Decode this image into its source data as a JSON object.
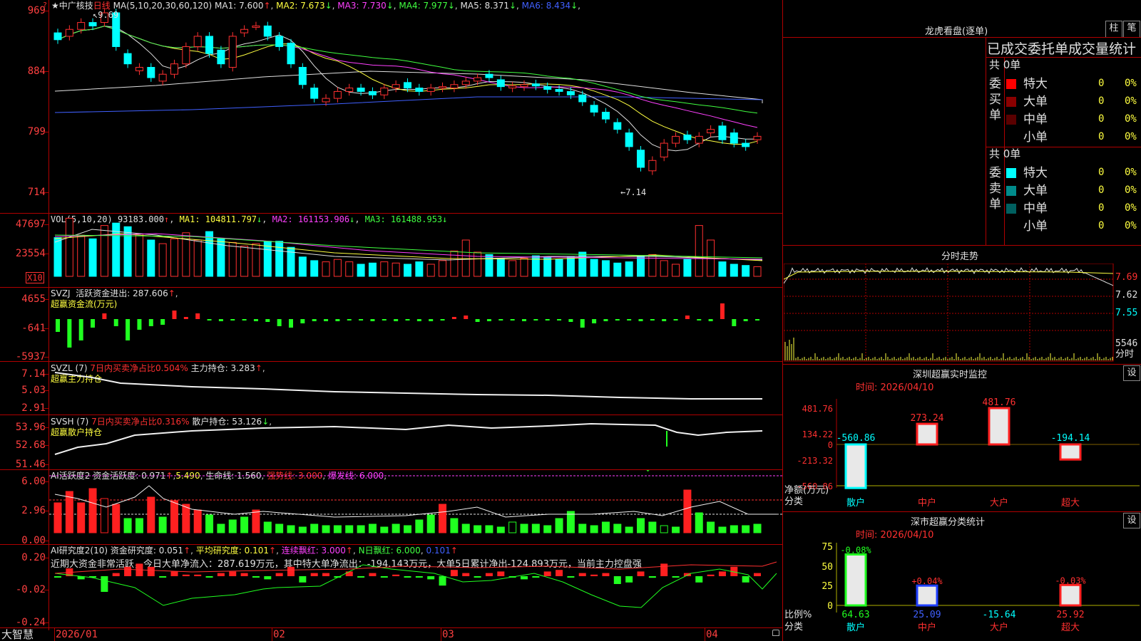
{
  "main": {
    "stock_name": "★中广核技",
    "period": "日线",
    "ma_label": "MA(5,10,20,30,60,120)",
    "ma_values": [
      {
        "label": "MA1: 7.600",
        "arrow": "↑",
        "color": "#e0e0e0"
      },
      {
        "label": "MA2: 7.673",
        "arrow": "↓",
        "color": "#ffff40"
      },
      {
        "label": "MA3: 7.730",
        "arrow": "↓",
        "color": "#ff40ff"
      },
      {
        "label": "MA4: 7.977",
        "arrow": "↓",
        "color": "#40ff40"
      },
      {
        "label": "MA5: 8.371",
        "arrow": "↓",
        "color": "#e0e0e0"
      },
      {
        "label": "MA6: 8.434",
        "arrow": "↓",
        "color": "#4060ff"
      }
    ],
    "y_ticks": [
      "969",
      "884",
      "799",
      "714"
    ],
    "high_marker": "9.69",
    "low_marker": "7.14"
  },
  "vol": {
    "label": "VOL(5,10,20)",
    "value": "93183.000",
    "ma1": "MA1: 104811.797",
    "ma2": "MA2: 161153.906",
    "ma3": "MA3: 161488.953",
    "y_ticks": [
      "47697",
      "23554"
    ],
    "unit": "X10"
  },
  "svzj": {
    "label": "SVZJ",
    "text1": "活跃资金进出: 287.606",
    "text2": "超赢资金流(万元)",
    "y_ticks": [
      "4655",
      "-641",
      "-5937"
    ]
  },
  "svzl": {
    "label": "SVZL (7)",
    "text1": "7日内买卖净占比0.504%",
    "text2": "主力持仓: 3.283",
    "text3": "超赢主力持仓",
    "y_ticks": [
      "7.14",
      "5.03",
      "2.91"
    ]
  },
  "svsh": {
    "label": "SVSH (7)",
    "text1": "7日内买卖净占比0.316%",
    "text2": "散户持仓: 53.126",
    "text3": "超赢散户持仓",
    "y_ticks": [
      "53.96",
      "52.68",
      "51.46"
    ]
  },
  "ai1": {
    "label": "AI活跃度2",
    "text1": "资金活跃度: 0.971",
    "text2": "5.490",
    "text3": "生命线: 1.560",
    "text4": "强势线: 3.000",
    "text5": "爆发线: 6.000",
    "y_ticks": [
      "6.00",
      "2.96",
      "0.00"
    ]
  },
  "ai2": {
    "label": "AI研究度2(10)",
    "text1": "资金研究度: 0.051",
    "text2": "平均研究度: 0.101",
    "text3": "连续飘红: 3.000",
    "text4": "N日飘红: 6.000",
    "text5": "0.101",
    "comment": "近期大资金非常活跃，今日大单净流入：287.619万元，其中特大单净流出：-194.143万元，大单5日累计净出-124.893万元，当前主力控盘强",
    "y_ticks": [
      "0.20",
      "-0.02",
      "-0.24"
    ]
  },
  "x_axis": {
    "brand": "大智慧",
    "dates": [
      "2026/01",
      "02",
      "03",
      "04"
    ]
  },
  "right": {
    "top_title": "龙虎看盘(逐单)",
    "btn_zhu": "柱",
    "btn_bi": "笔",
    "subtitle": "已成交委托单成交量统计",
    "buy": {
      "side_label": "委买单",
      "total": "共 0单",
      "rows": [
        {
          "name": "特大",
          "count": "0",
          "pct": "0%",
          "color": "#ff0000"
        },
        {
          "name": "大单",
          "count": "0",
          "pct": "0%",
          "color": "#8b0000"
        },
        {
          "name": "中单",
          "count": "0",
          "pct": "0%",
          "color": "#5a0000"
        },
        {
          "name": "小单",
          "count": "0",
          "pct": "0%",
          "color": "#000000"
        }
      ]
    },
    "sell": {
      "side_label": "委卖单",
      "total": "共 0单",
      "rows": [
        {
          "name": "特大",
          "count": "0",
          "pct": "0%",
          "color": "#00ffff"
        },
        {
          "name": "大单",
          "count": "0",
          "pct": "0%",
          "color": "#008b8b"
        },
        {
          "name": "中单",
          "count": "0",
          "pct": "0%",
          "color": "#006060"
        },
        {
          "name": "小单",
          "count": "0",
          "pct": "0%",
          "color": "#000000"
        }
      ]
    },
    "intraday": {
      "title": "分时走势",
      "y_ticks": [
        "7.69",
        "7.62",
        "7.55"
      ],
      "vol_tick": "5546",
      "vol_unit": "分时"
    },
    "monitor": {
      "title": "深圳超赢实时监控",
      "btn": "设",
      "time": "时间: 2026/04/10",
      "y_ticks": [
        "481.76",
        "134.22",
        "0",
        "-213.32",
        "-560.86"
      ],
      "bar_values": [
        -560.86,
        273.24,
        481.76,
        -194.14
      ],
      "bar_labels": [
        "-560.86",
        "273.24",
        "481.76",
        "-194.14"
      ],
      "categories": [
        "散户",
        "中户",
        "大户",
        "超大"
      ],
      "ylabel1": "净额(万元)",
      "ylabel2": "分类"
    },
    "stats": {
      "title": "深市超赢分类统计",
      "btn": "设",
      "time": "时间: 2026/04/10",
      "y_ticks": [
        "75",
        "50",
        "25",
        "0"
      ],
      "bar_values": [
        64.63,
        25.09,
        -15.64,
        25.92
      ],
      "bar_top_labels": [
        "-0.08%",
        "+0.04%",
        "",
        "-0.03%"
      ],
      "bar_bottom_labels": [
        "64.63",
        "25.09",
        "-15.64",
        "25.92"
      ],
      "categories": [
        "散户",
        "中户",
        "大户",
        "超大"
      ],
      "ylabel1": "比例%",
      "ylabel2": "分类"
    }
  }
}
